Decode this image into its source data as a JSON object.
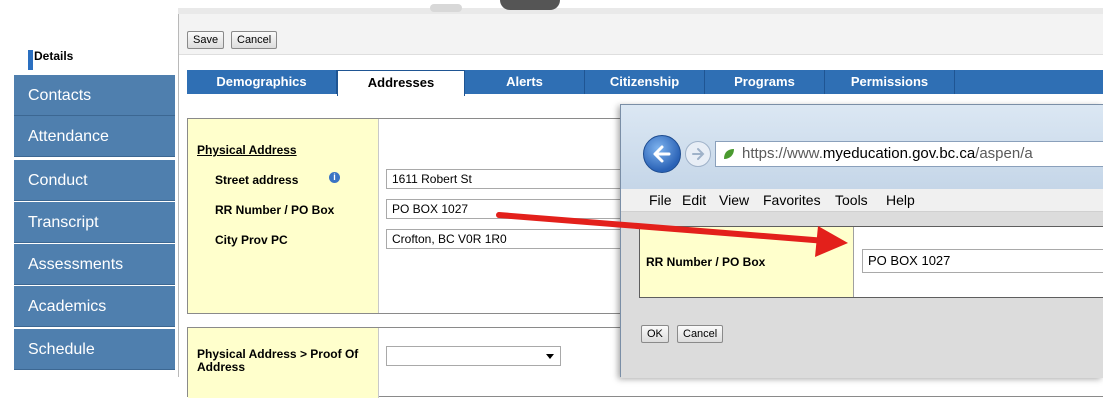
{
  "sidebar": {
    "items": [
      {
        "label": "Details",
        "active": true
      },
      {
        "label": "Contacts"
      },
      {
        "label": "Attendance"
      },
      {
        "label": "Conduct"
      },
      {
        "label": "Transcript"
      },
      {
        "label": "Assessments"
      },
      {
        "label": "Academics"
      },
      {
        "label": "Schedule"
      }
    ]
  },
  "toolbar": {
    "save_label": "Save",
    "cancel_label": "Cancel"
  },
  "tabs": [
    {
      "label": "Demographics"
    },
    {
      "label": "Addresses",
      "active": true
    },
    {
      "label": "Alerts"
    },
    {
      "label": "Citizenship"
    },
    {
      "label": "Programs"
    },
    {
      "label": "Permissions"
    }
  ],
  "address": {
    "section_title": "Physical Address",
    "street_label": "Street address",
    "street_value": "1611 Robert St",
    "rr_label": "RR Number / PO Box",
    "rr_value": "PO BOX 1027",
    "city_label": "City Prov PC",
    "city_value": "Crofton, BC V0R 1R0"
  },
  "proof": {
    "label": "Physical Address > Proof Of Address",
    "value": ""
  },
  "popup": {
    "url_prefix": "https://www.",
    "url_domain": "myeducation.gov.bc.ca",
    "url_suffix": "/aspen/a",
    "menu": [
      "File",
      "Edit",
      "View",
      "Favorites",
      "Tools",
      "Help"
    ],
    "field_label": "RR Number / PO Box",
    "field_value": "PO BOX 1027",
    "ok_label": "OK",
    "cancel_label": "Cancel"
  },
  "colors": {
    "sidebar": "#4f7fae",
    "tabs": "#2f6fb4",
    "label_bg": "#ffffcc",
    "arrow": "#e3201b"
  }
}
